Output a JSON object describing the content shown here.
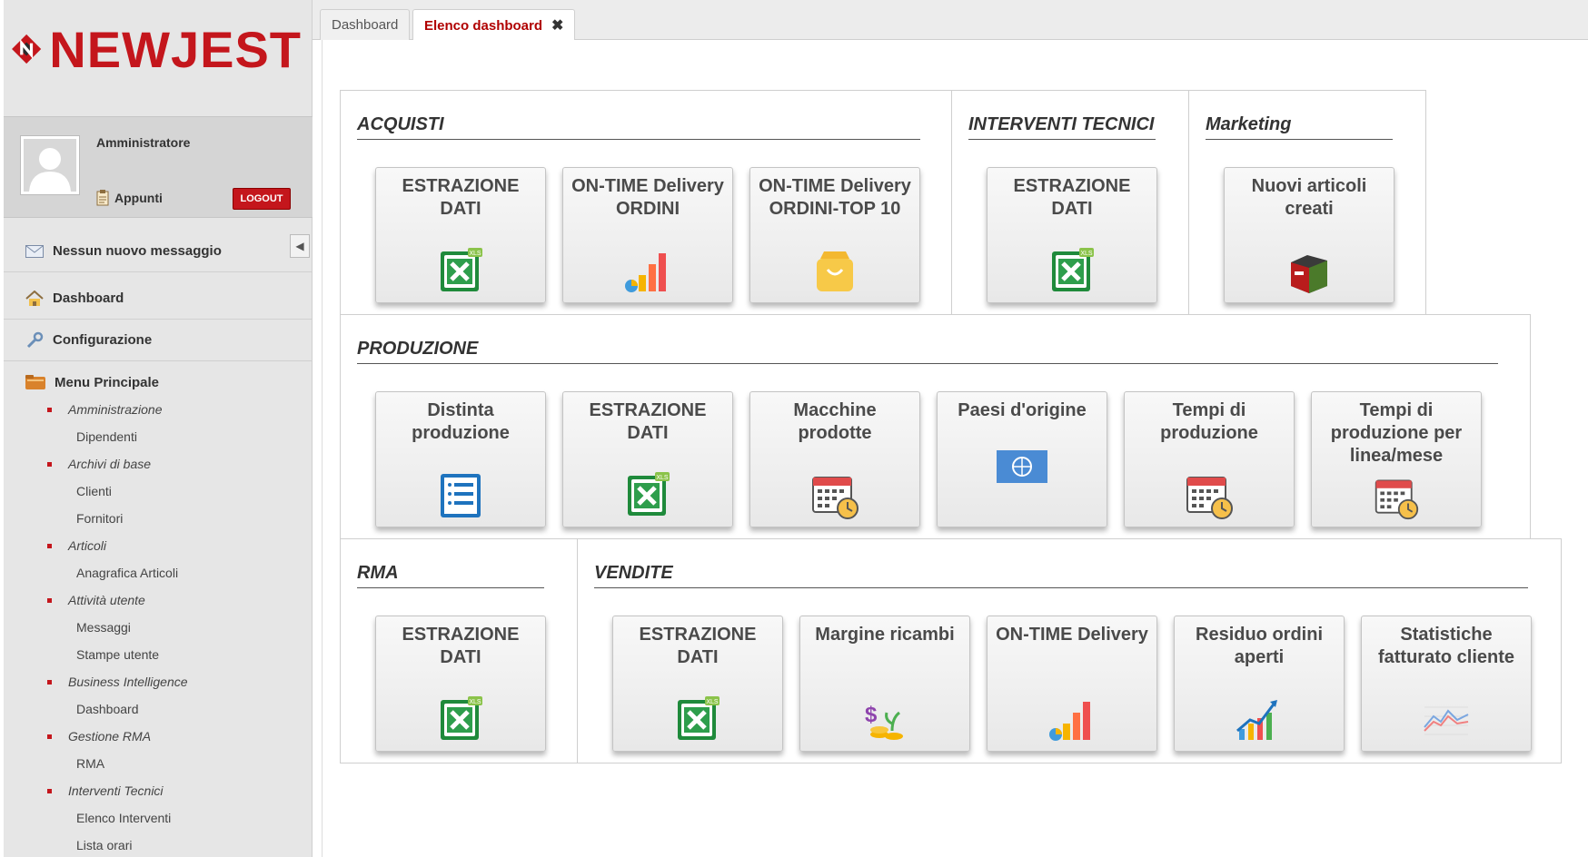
{
  "sidebar": {
    "logo_text": "NEWJEST",
    "user_name": "Amministratore",
    "appunti": "Appunti",
    "logout": "LOGOUT",
    "messages": "Nessun nuovo messaggio",
    "dashboard": "Dashboard",
    "configurazione": "Configurazione",
    "menu_principale": "Menu Principale",
    "menu": [
      {
        "type": "cat",
        "label": "Amministrazione"
      },
      {
        "type": "sub",
        "label": "Dipendenti"
      },
      {
        "type": "cat",
        "label": "Archivi di base"
      },
      {
        "type": "sub",
        "label": "Clienti"
      },
      {
        "type": "sub",
        "label": "Fornitori"
      },
      {
        "type": "cat",
        "label": "Articoli"
      },
      {
        "type": "sub",
        "label": "Anagrafica Articoli"
      },
      {
        "type": "cat",
        "label": "Attività utente"
      },
      {
        "type": "sub",
        "label": "Messaggi"
      },
      {
        "type": "sub",
        "label": "Stampe utente"
      },
      {
        "type": "cat",
        "label": "Business Intelligence"
      },
      {
        "type": "sub",
        "label": "Dashboard"
      },
      {
        "type": "cat",
        "label": "Gestione RMA"
      },
      {
        "type": "sub",
        "label": "RMA"
      },
      {
        "type": "cat",
        "label": "Interventi Tecnici"
      },
      {
        "type": "sub",
        "label": "Elenco Interventi"
      },
      {
        "type": "sub",
        "label": "Lista orari"
      }
    ]
  },
  "tabs": [
    {
      "label": "Dashboard"
    },
    {
      "label": "Elenco dashboard"
    }
  ],
  "sections": {
    "acquisti": {
      "title": "ACQUISTI",
      "tiles": [
        "ESTRAZIONE DATI",
        "ON-TIME Delivery ORDINI",
        "ON-TIME Delivery ORDINI-TOP 10"
      ]
    },
    "interventi": {
      "title": "INTERVENTI TECNICI",
      "tiles": [
        "ESTRAZIONE DATI"
      ]
    },
    "marketing": {
      "title": "Marketing",
      "tiles": [
        "Nuovi articoli creati"
      ]
    },
    "produzione": {
      "title": "PRODUZIONE",
      "tiles": [
        "Distinta produzione",
        "ESTRAZIONE DATI",
        "Macchine prodotte",
        "Paesi d'origine",
        "Tempi di produzione",
        "Tempi di produzione per linea/mese"
      ]
    },
    "rma": {
      "title": "RMA",
      "tiles": [
        "ESTRAZIONE DATI"
      ]
    },
    "vendite": {
      "title": "VENDITE",
      "tiles": [
        "ESTRAZIONE DATI",
        "Margine ricambi",
        "ON-TIME Delivery",
        "Residuo ordini aperti",
        "Statistiche fatturato cliente"
      ]
    }
  },
  "colors": {
    "brand": "#c4161c",
    "excel": "#1f8a3b"
  }
}
